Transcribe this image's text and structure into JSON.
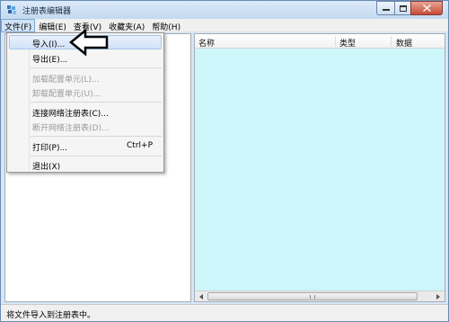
{
  "window": {
    "title": "注册表编辑器",
    "caption_buttons": {
      "minimize": "minimize-icon",
      "maximize": "maximize-icon",
      "close": "close-icon"
    }
  },
  "menubar": {
    "items": [
      {
        "label": "文件(F)",
        "active": true
      },
      {
        "label": "编辑(E)"
      },
      {
        "label": "查看(V)"
      },
      {
        "label": "收藏夹(A)"
      },
      {
        "label": "帮助(H)"
      }
    ]
  },
  "file_menu": {
    "items": [
      {
        "label": "导入(I)...",
        "state": "highlighted"
      },
      {
        "label": "导出(E)..."
      },
      {
        "label": "加载配置单元(L)...",
        "state": "disabled"
      },
      {
        "label": "卸载配置单元(U)...",
        "state": "disabled"
      },
      {
        "label": "连接网络注册表(C)..."
      },
      {
        "label": "断开网络注册表(D)...",
        "state": "disabled"
      },
      {
        "label": "打印(P)...",
        "shortcut": "Ctrl+P"
      },
      {
        "label": "退出(X)"
      }
    ]
  },
  "list": {
    "columns": [
      "名称",
      "类型",
      "数据"
    ]
  },
  "statusbar": {
    "text": "将文件导入到注册表中。"
  },
  "colors": {
    "list_background": "#cdf6fa",
    "highlight": "#d1e3f7",
    "disabled_text": "#9a9a9a"
  }
}
